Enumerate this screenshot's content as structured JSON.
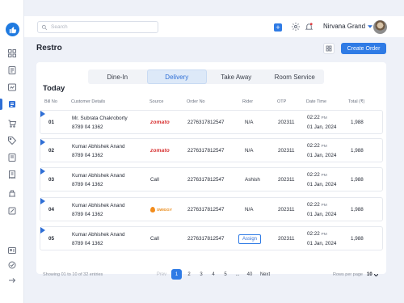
{
  "search": {
    "placeholder": "Search"
  },
  "topbar": {
    "user_name": "Nirvana Grand",
    "plus_label": "+"
  },
  "page": {
    "title": "Restro",
    "create_order_label": "Create Order"
  },
  "tabs": [
    {
      "label": "Dine-In",
      "active": false
    },
    {
      "label": "Delivery",
      "active": true
    },
    {
      "label": "Take Away",
      "active": false
    },
    {
      "label": "Room Service",
      "active": false
    }
  ],
  "section": {
    "title": "Today"
  },
  "columns": {
    "bill": "Bill No",
    "customer": "Customer Details",
    "source": "Source",
    "order": "Order No",
    "rider": "Rider",
    "otp": "OTP",
    "datetime": "Date Time",
    "total": "Total (₹)"
  },
  "rows": [
    {
      "bill": "01",
      "name": "Mr. Subrata Chakroborty",
      "phone": "8789 04 1362",
      "source": "zomato",
      "order": "2276317812547",
      "rider": "N/A",
      "otp": "202311",
      "time": "02:22",
      "ampm": "PM",
      "date": "01 Jan, 2024",
      "total": "1,988"
    },
    {
      "bill": "02",
      "name": "Kumar Abhishek Anand",
      "phone": "8789 04 1362",
      "source": "zomato",
      "order": "2276317812547",
      "rider": "N/A",
      "otp": "202311",
      "time": "02:22",
      "ampm": "PM",
      "date": "01 Jan, 2024",
      "total": "1,988"
    },
    {
      "bill": "03",
      "name": "Kumar Abhishek Anand",
      "phone": "8789 04 1362",
      "source": "Call",
      "order": "2276317812547",
      "rider": "Ashish",
      "otp": "202311",
      "time": "02:22",
      "ampm": "PM",
      "date": "01 Jan, 2024",
      "total": "1,988"
    },
    {
      "bill": "04",
      "name": "Kumar Abhishek Anand",
      "phone": "8789 04 1362",
      "source": "SWIGGY",
      "order": "2276317812547",
      "rider": "N/A",
      "otp": "202311",
      "time": "02:22",
      "ampm": "PM",
      "date": "01 Jan, 2024",
      "total": "1,988"
    },
    {
      "bill": "05",
      "name": "Kumar Abhishek Anand",
      "phone": "8789 04 1362",
      "source": "Call",
      "order": "2276317812547",
      "rider": "Assign",
      "otp": "202311",
      "time": "02:22",
      "ampm": "PM",
      "date": "01 Jan, 2024",
      "total": "1,988"
    }
  ],
  "footer": {
    "info": "Showing 01 to 10 of 32 entries",
    "prev": "Prev",
    "pages": [
      "1",
      "2",
      "3",
      "4",
      "5",
      "...",
      "40"
    ],
    "next": "Next",
    "rows_label": "Rows per page",
    "rows_value": "10"
  },
  "colors": {
    "accent": "#2f7be5",
    "zomato": "#d62b2b",
    "swiggy": "#f28c1c",
    "background": "#eef1f8"
  }
}
